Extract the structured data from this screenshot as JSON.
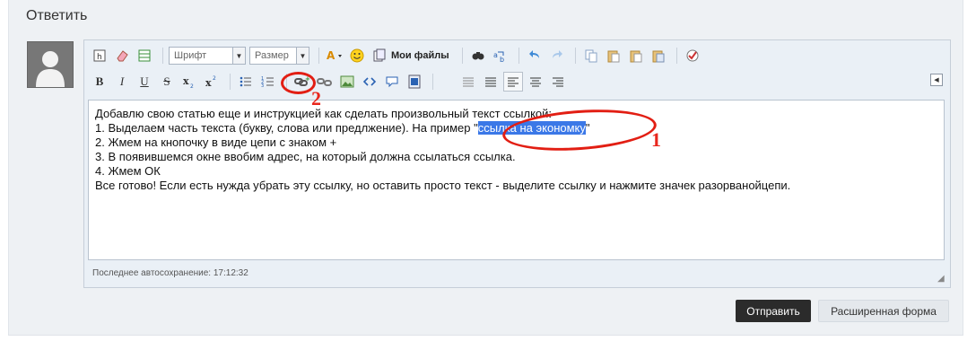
{
  "header": {
    "title": "Ответить"
  },
  "toolbar": {
    "font_combo": "Шрифт",
    "size_combo": "Размер",
    "my_files": "Мои файлы",
    "bold": "B",
    "italic": "I",
    "underline": "U",
    "strike": "S"
  },
  "editor": {
    "lines": [
      "Добавлю свою статью еще и инструкцией как сделать произвольный текст ссылкой:",
      "1. Выделаем часть текста (букву, слова или предлжение). На пример \"",
      "ссылка на экономку",
      "\"",
      "2. Жмем на кнопочку в виде цепи с знаком +",
      "3. В появившемся окне ввобим адрес, на который должна ссылаться ссылка.",
      "4. Жмем ОК",
      "Все готово! Если есть нужда убрать эту ссылку, но оставить просто текст - выделите ссылку и нажмите значек разорванойцепи."
    ],
    "autosave": "Последнее автосохранение: 17:12:32"
  },
  "buttons": {
    "send": "Отправить",
    "extended": "Расширенная форма"
  },
  "annotations": {
    "label_1": "1",
    "label_2": "2",
    "color": "#e21e13"
  },
  "icons": [
    "source-icon",
    "eraser-icon",
    "table-icon",
    "font-color-icon",
    "smiley-icon",
    "my-files-icon",
    "find-icon",
    "replace-icon",
    "undo-icon",
    "redo-icon",
    "copy-icon",
    "paste-icon",
    "paste-text-icon",
    "paste-word-icon",
    "spellcheck-icon",
    "bold-icon",
    "italic-icon",
    "underline-icon",
    "strike-icon",
    "subscript-icon",
    "superscript-icon",
    "bullet-list-icon",
    "numbered-list-icon",
    "link-add-icon",
    "link-remove-icon",
    "image-icon",
    "code-icon",
    "quote-icon",
    "video-icon",
    "align-justify-icon",
    "align-left-icon",
    "align-center-icon",
    "align-right-icon"
  ]
}
